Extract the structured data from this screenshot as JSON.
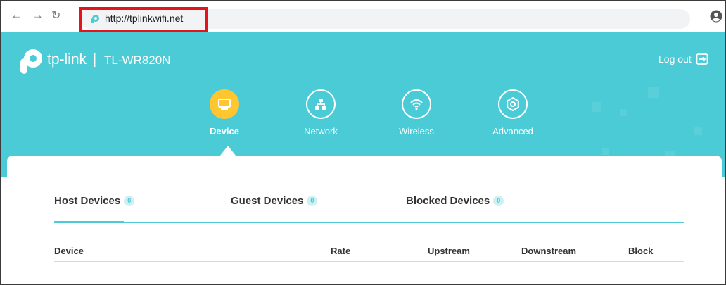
{
  "browser": {
    "back_icon": "arrow-left-icon",
    "forward_icon": "arrow-right-icon",
    "reload_icon": "reload-icon",
    "url": "http://tplinkwifi.net",
    "profile_icon": "account-circle-icon",
    "highlight_color": "#e5141b"
  },
  "header": {
    "brand": "tp-link",
    "separator": "|",
    "model": "TL-WR820N",
    "logout_label": "Log out",
    "background": "#4acbd6"
  },
  "nav": {
    "items": [
      {
        "label": "Device",
        "icon": "monitor-icon",
        "active": true
      },
      {
        "label": "Network",
        "icon": "network-icon",
        "active": false
      },
      {
        "label": "Wireless",
        "icon": "wifi-icon",
        "active": false
      },
      {
        "label": "Advanced",
        "icon": "gear-icon",
        "active": false
      }
    ],
    "active_color": "#ffc630"
  },
  "tabs": [
    {
      "label": "Host Devices",
      "count": "0",
      "active": true
    },
    {
      "label": "Guest Devices",
      "count": "0",
      "active": false
    },
    {
      "label": "Blocked Devices",
      "count": "0",
      "active": false
    }
  ],
  "table": {
    "columns": [
      "Device",
      "Rate",
      "Upstream",
      "Downstream",
      "Block"
    ]
  }
}
